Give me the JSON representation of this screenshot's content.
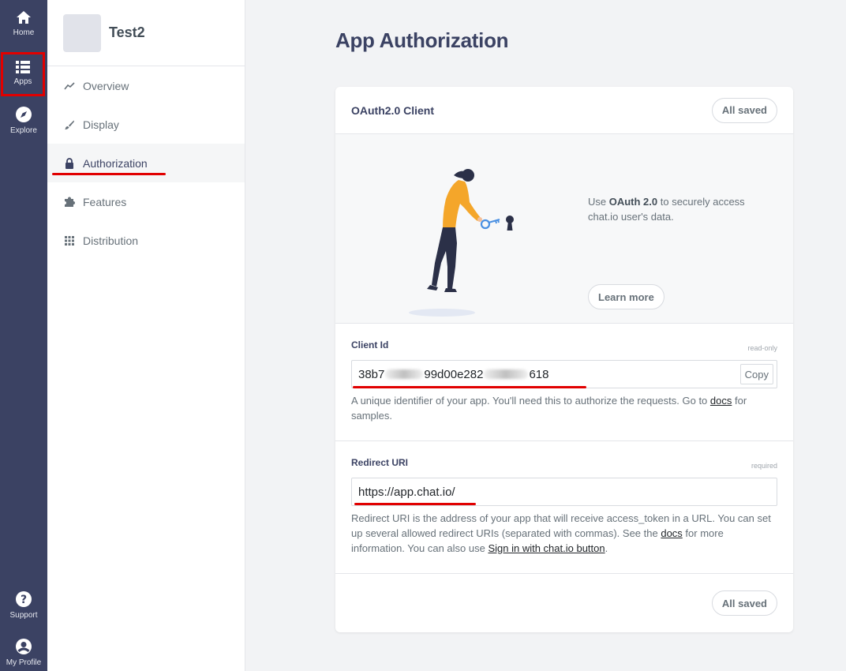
{
  "rail": {
    "home_label": "Home",
    "apps_label": "Apps",
    "explore_label": "Explore",
    "support_label": "Support",
    "profile_label": "My Profile"
  },
  "sidebar": {
    "app_name": "Test2",
    "items": [
      {
        "label": "Overview",
        "icon": "chart-line-icon"
      },
      {
        "label": "Display",
        "icon": "brush-icon"
      },
      {
        "label": "Authorization",
        "icon": "lock-icon",
        "active": true
      },
      {
        "label": "Features",
        "icon": "puzzle-icon"
      },
      {
        "label": "Distribution",
        "icon": "grid-dots-icon"
      }
    ]
  },
  "main": {
    "title": "App Authorization",
    "card": {
      "title": "OAuth2.0 Client",
      "status_top": "All saved",
      "hero": {
        "text_pre": "Use ",
        "text_bold": "OAuth 2.0",
        "text_post": " to securely access chat.io user's data.",
        "learn_more": "Learn more"
      },
      "client_id": {
        "label": "Client Id",
        "tag": "read-only",
        "value_part1": "38b7",
        "value_part2": "99d00e282",
        "value_part3": "618",
        "copy_label": "Copy",
        "help_pre": "A unique identifier of your app. You'll need this to authorize the requests. Go to ",
        "help_link": "docs",
        "help_post": " for samples."
      },
      "redirect": {
        "label": "Redirect URI",
        "tag": "required",
        "value": "https://app.chat.io/",
        "help_pre": "Redirect URI is the address of your app that will receive access_token in a URL. You can set up several allowed redirect URIs (separated with commas). See the ",
        "help_link1": "docs",
        "help_mid": " for more information. You can also use ",
        "help_link2": "Sign in with chat.io button",
        "help_post": "."
      },
      "status_bottom": "All saved"
    }
  },
  "colors": {
    "rail_bg": "#3b4263",
    "annotation_red": "#e10000",
    "illustration_orange": "#f4a62a",
    "illustration_blue": "#4a90e2"
  }
}
